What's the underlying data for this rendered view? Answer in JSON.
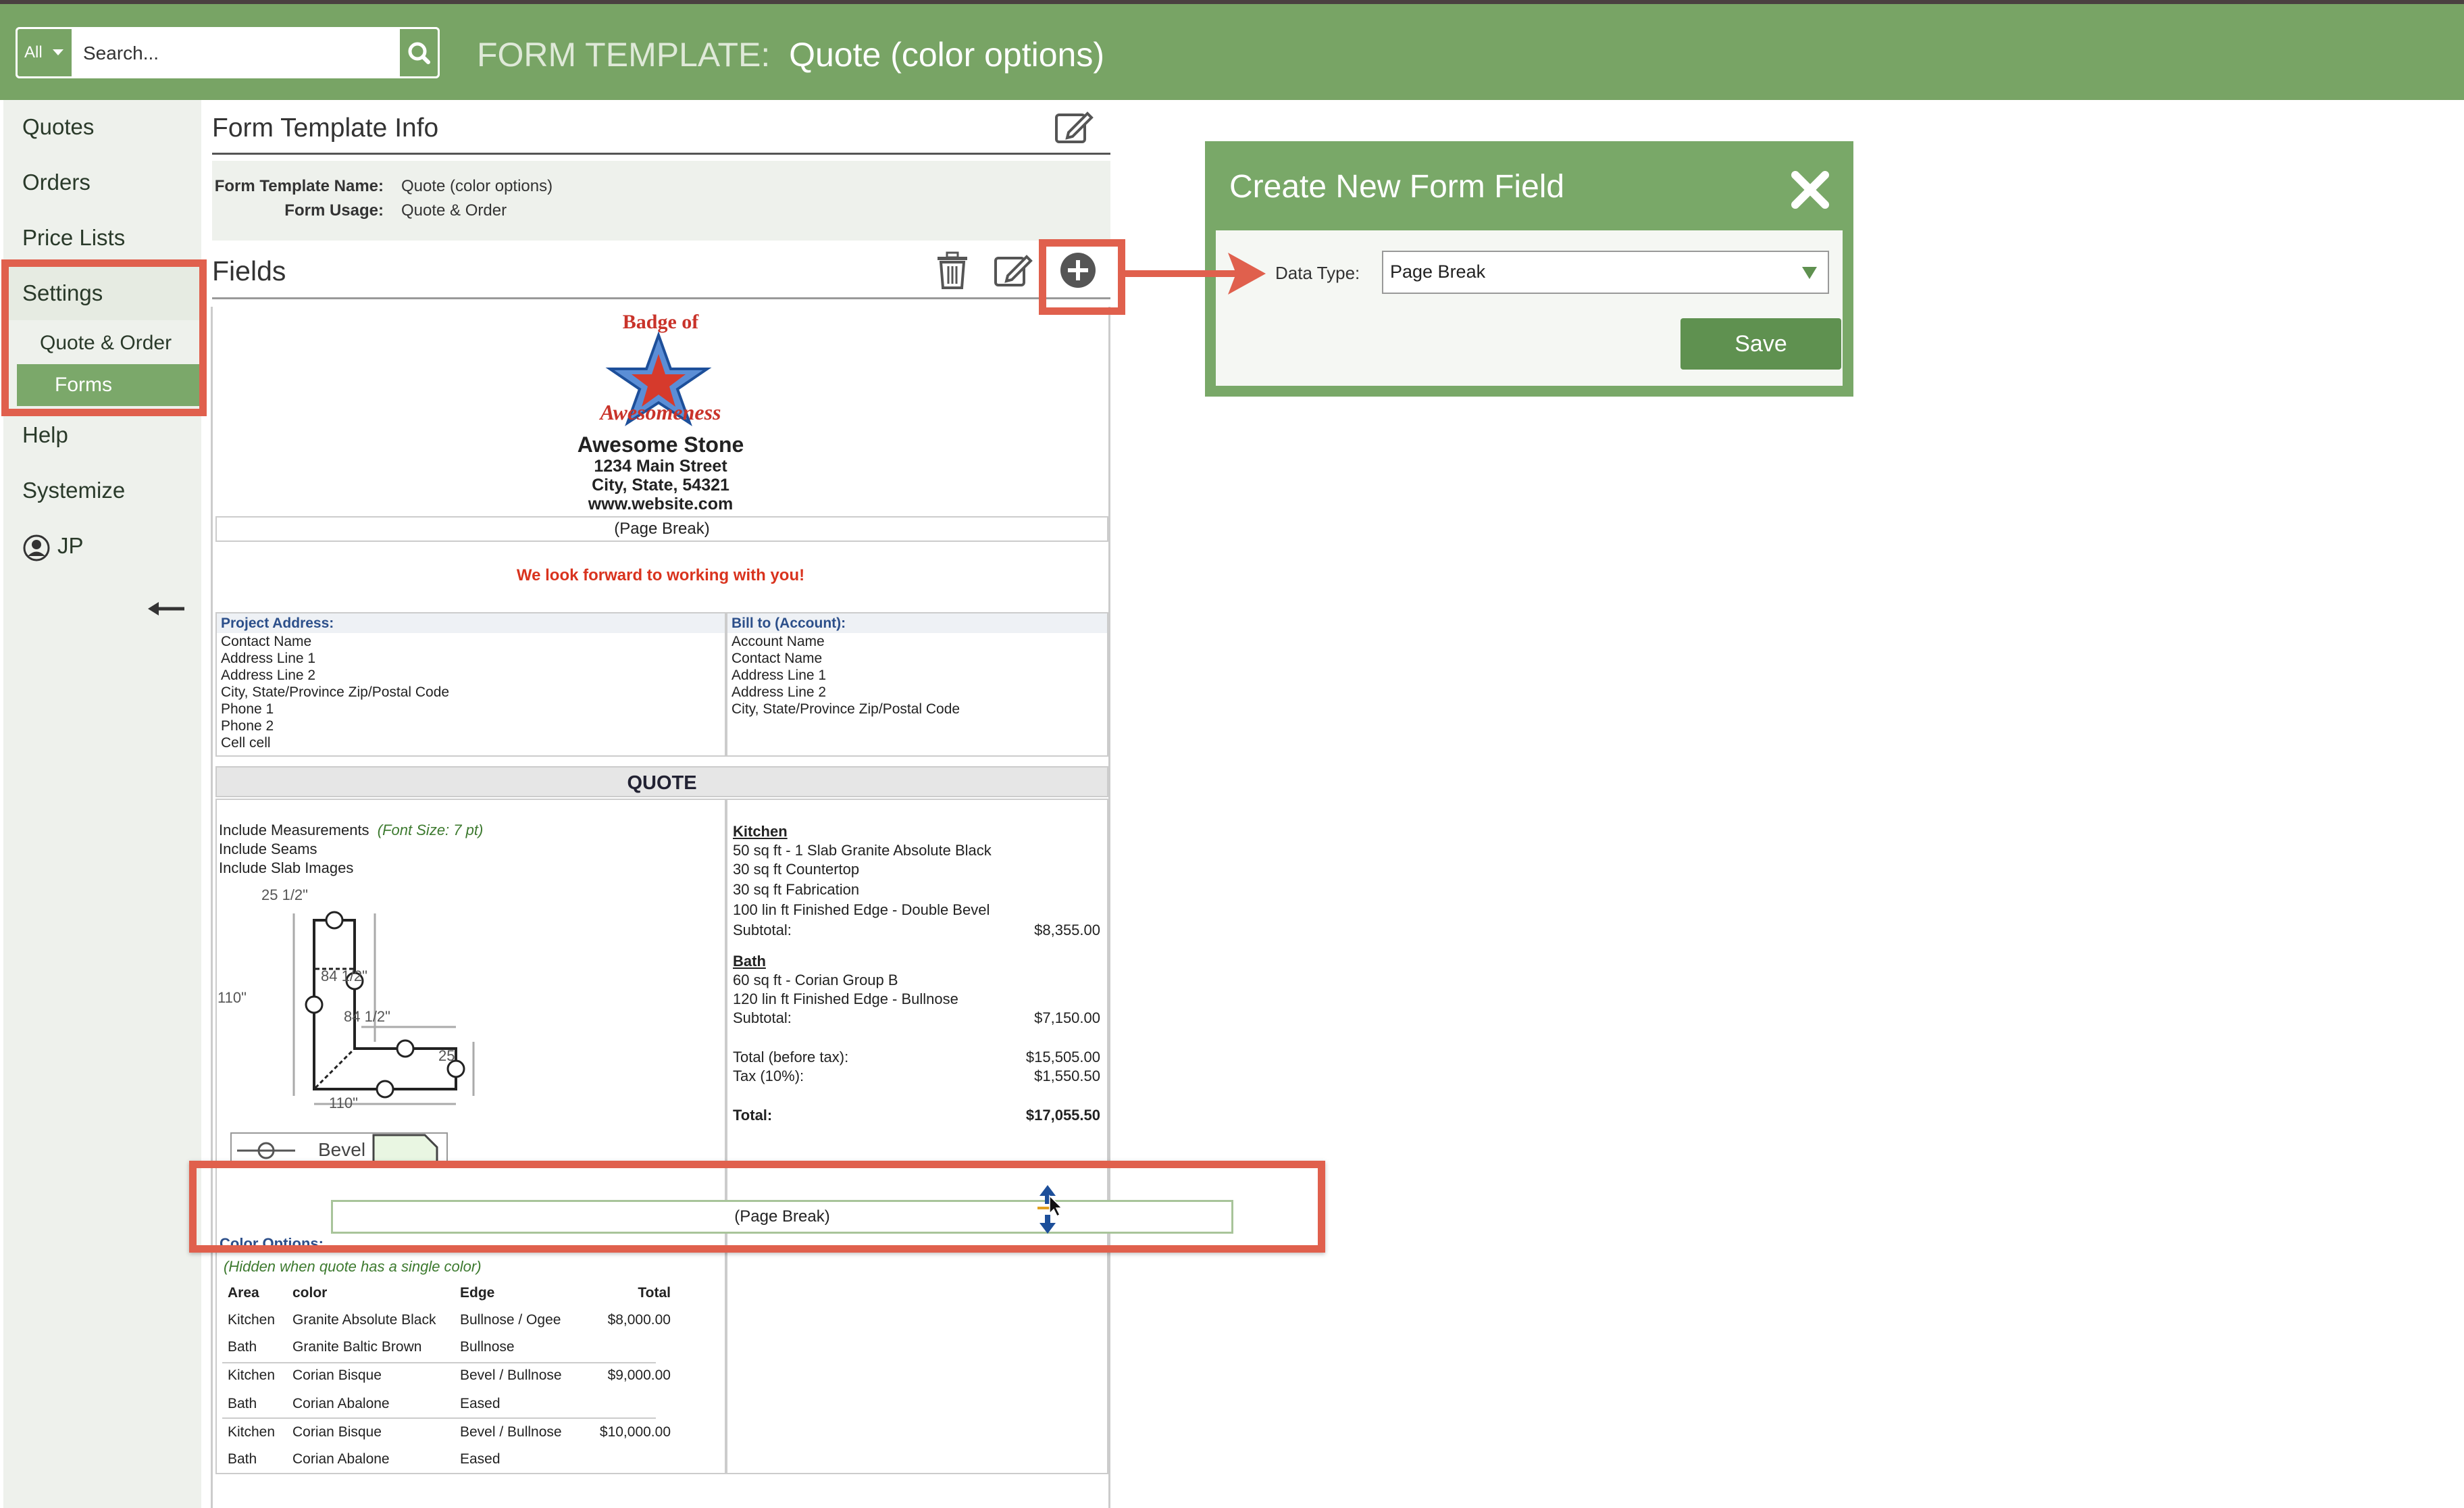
{
  "header": {
    "search_scope": "All",
    "search_placeholder": "Search...",
    "title_label": "FORM TEMPLATE:",
    "title_value": "Quote (color options)"
  },
  "sidebar": {
    "items": [
      "Quotes",
      "Orders",
      "Price Lists",
      "Settings"
    ],
    "sub_items": [
      "Quote & Order",
      "Forms"
    ],
    "items_after": [
      "Help",
      "Systemize"
    ],
    "user": "JP"
  },
  "form_info": {
    "title": "Form Template Info",
    "name_label": "Form Template Name:",
    "name_value": "Quote (color options)",
    "usage_label": "Form Usage:",
    "usage_value": "Quote & Order"
  },
  "fields": {
    "title": "Fields"
  },
  "document": {
    "logo_top": "Badge of",
    "logo_bottom": "Awesomeness",
    "company": "Awesome Stone",
    "address": "1234 Main Street",
    "city": "City, State, 54321",
    "website": "www.website.com",
    "page_break": "(Page Break)",
    "tagline": "We look forward to working with you!",
    "project_address": {
      "header": "Project Address:",
      "lines": [
        "Contact Name",
        "Address Line 1",
        "Address Line 2",
        "City, State/Province Zip/Postal Code",
        "Phone 1",
        "Phone 2",
        "Cell cell"
      ]
    },
    "bill_to": {
      "header": "Bill to (Account):",
      "lines": [
        "Account Name",
        "Contact Name",
        "Address Line 1",
        "Address Line 2",
        "City, State/Province Zip/Postal Code"
      ]
    },
    "quote_header": "QUOTE",
    "include_measurements": "Include Measurements",
    "font_size_note": "(Font Size: 7 pt)",
    "include_seams": "Include Seams",
    "include_slab_images": "Include Slab Images",
    "drawing_labels": {
      "top": "25 1/2\"",
      "left": "110\"",
      "inner_right": "84 1/2\"",
      "inner_bottom": "84 1/2\"",
      "right": "25",
      "bottom": "110\"",
      "bevel": "Bevel"
    },
    "kitchen": {
      "title": "Kitchen",
      "lines": [
        "50 sq ft - 1 Slab Granite Absolute Black",
        "30 sq ft Countertop",
        "30 sq ft Fabrication",
        "100 lin ft Finished Edge - Double Bevel"
      ],
      "subtotal_label": "Subtotal:",
      "subtotal": "$8,355.00"
    },
    "bath": {
      "title": "Bath",
      "lines": [
        "60 sq ft - Corian Group B",
        "120 lin ft Finished Edge - Bullnose"
      ],
      "subtotal_label": "Subtotal:",
      "subtotal": "$7,150.00"
    },
    "totals": {
      "before_tax_label": "Total (before tax):",
      "before_tax": "$15,505.00",
      "tax_label": "Tax (10%):",
      "tax": "$1,550.50",
      "total_label": "Total:",
      "total": "$17,055.50"
    },
    "color_options_title": "Color Options:",
    "color_options_note": "(Hidden when quote has a single color)",
    "color_table": {
      "headers": [
        "Area",
        "color",
        "Edge",
        "Total"
      ],
      "rows": [
        [
          "Kitchen",
          "Granite Absolute Black",
          "Bullnose / Ogee",
          "$8,000.00"
        ],
        [
          "Bath",
          "Granite Baltic Brown",
          "Bullnose",
          ""
        ],
        [
          "Kitchen",
          "Corian Bisque",
          "Bevel / Bullnose",
          "$9,000.00"
        ],
        [
          "Bath",
          "Corian Abalone",
          "Eased",
          ""
        ],
        [
          "Kitchen",
          "Corian Bisque",
          "Bevel / Bullnose",
          "$10,000.00"
        ],
        [
          "Bath",
          "Corian Abalone",
          "Eased",
          ""
        ]
      ]
    }
  },
  "modal": {
    "title": "Create New Form Field",
    "data_type_label": "Data Type:",
    "data_type_value": "Page Break",
    "save_label": "Save"
  },
  "colors": {
    "brand_green": "#78a465",
    "highlight": "#e0604d",
    "tagline_red": "#d9331e"
  }
}
